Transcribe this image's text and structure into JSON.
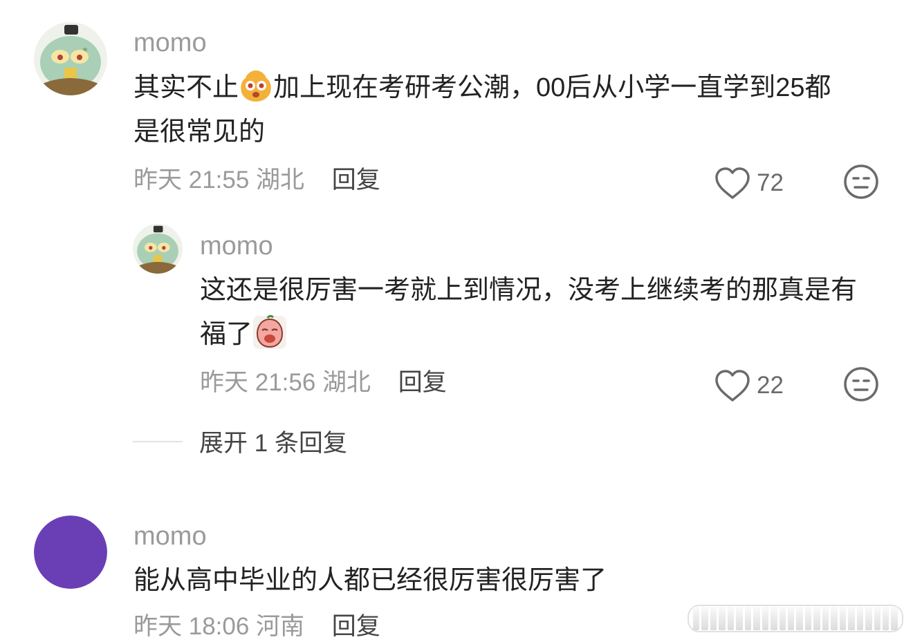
{
  "comments": [
    {
      "username": "momo",
      "text_before_emoji": "其实不止",
      "text_after_emoji": "加上现在考研考公潮，00后从小学一直学到25都是很常见的",
      "emoji": "shocked-face-emoji",
      "time": "昨天 21:55",
      "location": "湖北",
      "reply_label": "回复",
      "likes": "72"
    },
    {
      "username": "momo",
      "text": "这还是很厉害一考就上到情况，没考上继续考的那真是有福了",
      "emoji": "crying-face-emoji",
      "time": "昨天 21:56",
      "location": "湖北",
      "reply_label": "回复",
      "likes": "22"
    },
    {
      "username": "momo",
      "text": "能从高中毕业的人都已经很厉害很厉害了",
      "time": "昨天 18:06",
      "location": "河南",
      "reply_label": "回复"
    }
  ],
  "expand_replies_label": "展开 1 条回复",
  "colors": {
    "avatar_purple": "#6a3fb5",
    "muted_text": "#9a9a9a"
  }
}
